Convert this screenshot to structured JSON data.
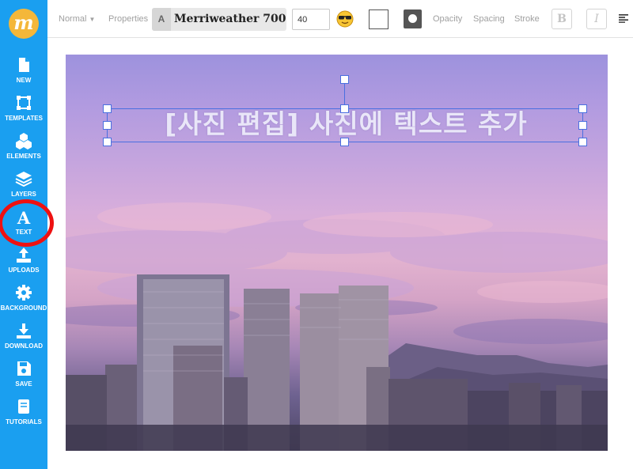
{
  "sidebar": {
    "logo_letter": "m",
    "items": [
      {
        "label": "NEW",
        "icon": "file-icon"
      },
      {
        "label": "TEMPLATES",
        "icon": "templates-icon"
      },
      {
        "label": "ELEMENTS",
        "icon": "shapes-icon"
      },
      {
        "label": "LAYERS",
        "icon": "layers-icon"
      },
      {
        "label": "TEXT",
        "icon": "text-icon"
      },
      {
        "label": "UPLOADS",
        "icon": "upload-icon"
      },
      {
        "label": "BACKGROUND",
        "icon": "gear-icon"
      },
      {
        "label": "DOWNLOAD",
        "icon": "download-icon"
      },
      {
        "label": "SAVE",
        "icon": "floppy-icon"
      },
      {
        "label": "TUTORIALS",
        "icon": "book-icon"
      }
    ],
    "active_item": "TEXT",
    "highlight_color": "#ee1111"
  },
  "toolbar": {
    "style_label": "Normal",
    "properties_label": "Properties",
    "font_letter": "A",
    "font_name": "Merriweather 700",
    "font_size": "40",
    "emoji_icon": "sunglasses-emoji-icon",
    "opacity_label": "Opacity",
    "spacing_label": "Spacing",
    "stroke_label": "Stroke",
    "bold_label": "B",
    "italic_label": "I",
    "align_icon": "align-left-icon"
  },
  "canvas": {
    "headline": "[사진 편집] 사진에 텍스트 추가",
    "selection_color": "#4a6fe0"
  },
  "colors": {
    "sidebar": "#1a9ff0",
    "logo": "#f4b73a",
    "headline_text": "#e9e6f8"
  }
}
